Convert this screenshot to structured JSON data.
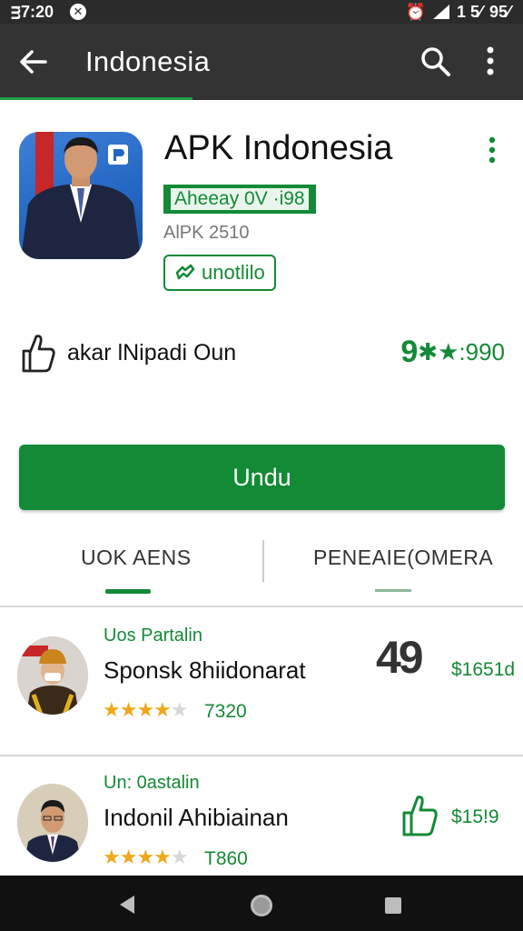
{
  "status_bar": {
    "time": "ᴟ7:20",
    "network": "1 5⁄",
    "battery": "95⁄"
  },
  "app_bar": {
    "title": "Indonesia"
  },
  "app": {
    "name": "APK Indonesia",
    "developer_badge": "Aheeay 0V ·i98",
    "size": "AlPK 2510",
    "tag": "unotlilo"
  },
  "like_row": {
    "text": "akar lNipadi Oun"
  },
  "rating": {
    "big": "9",
    "text": "✱★:990"
  },
  "install_button": {
    "label": "Undu"
  },
  "tabs": [
    {
      "label": "UOK AENS"
    },
    {
      "label": "PENEAIE(OMERA"
    }
  ],
  "items": [
    {
      "category": "Uos Partalin",
      "name": "Sponsk 8hiidonarat",
      "stars_full": "★★★★",
      "stars_empty": "★",
      "count": "7320",
      "big_number": "49",
      "price": "$1651d"
    },
    {
      "category": "Un: 0astalin",
      "name": "Indonil Ahibiainan",
      "stars_full": "★★★★",
      "stars_empty": "★",
      "count": "T860",
      "price": "$15!9"
    }
  ],
  "colors": {
    "accent": "#138a36",
    "app_bar": "#333333",
    "status_bar": "#2b2b2b",
    "star": "#f0a81c"
  }
}
